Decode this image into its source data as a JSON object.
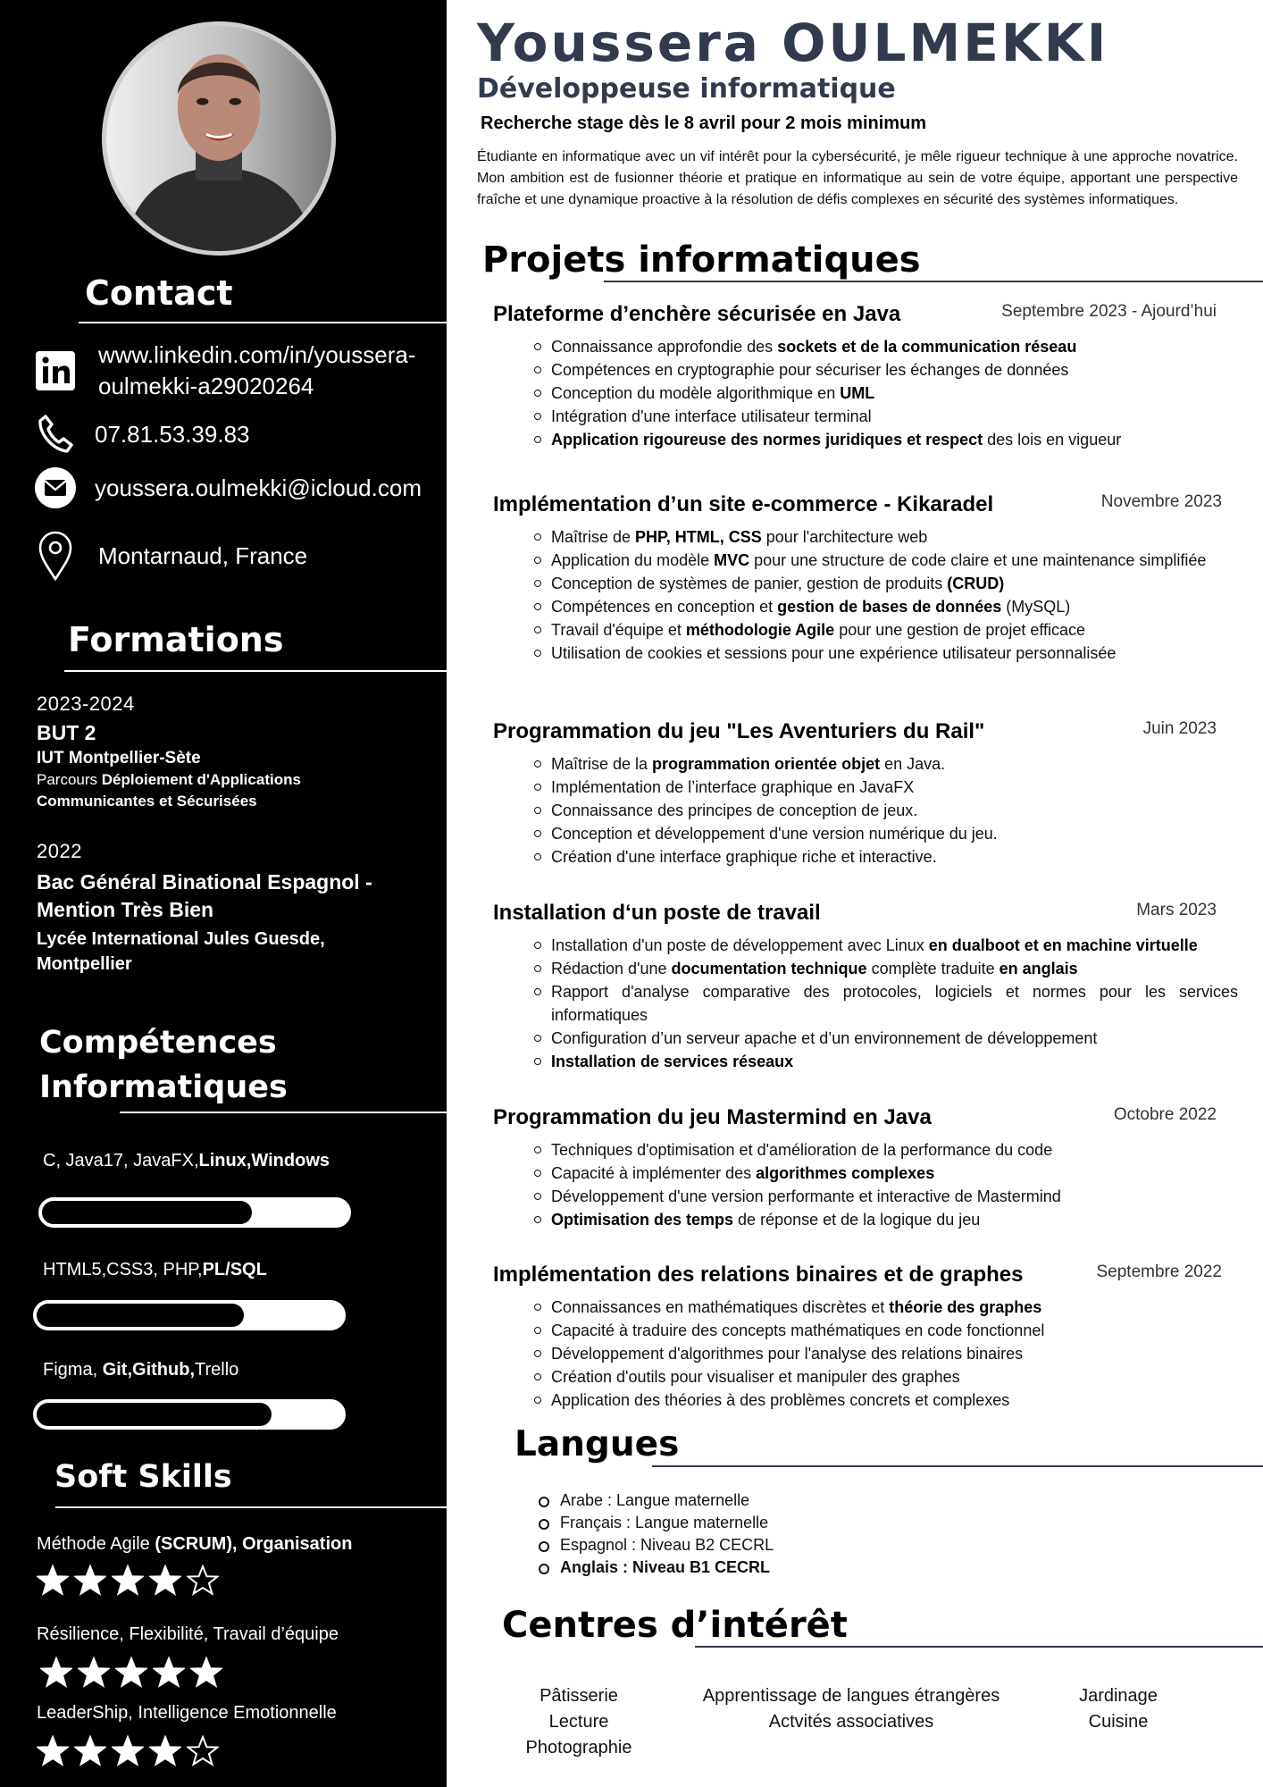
{
  "sidebar": {
    "contact_title": "Contact",
    "contact": {
      "linkedin_line1": "www.linkedin.com/in/youssera-",
      "linkedin_line2": "oulmekki-a29020264",
      "phone": "07.81.53.39.83",
      "email": "youssera.oulmekki@icloud.com",
      "location": "Montarnaud, France"
    },
    "formations_title": "Formations",
    "formations": [
      {
        "year": "2023-2024",
        "degree": "BUT 2",
        "school": "IUT Montpellier-Sète",
        "track_prefix": "Parcours ",
        "track_line1": "Déploiement d'Applications",
        "track_line2": "Communicantes et Sécurisées"
      },
      {
        "year": "2022",
        "degree_line1": "Bac Général Binational Espagnol -",
        "degree_line2": "Mention Très Bien",
        "school_line1": "Lycée International Jules Guesde,",
        "school_line2": "Montpellier"
      }
    ],
    "skills_title_line1": "Compétences",
    "skills_title_line2": "Informatiques",
    "skills": [
      {
        "plain": "C, Java17, JavaFX,",
        "bold": "Linux,Windows",
        "level_pct": 68
      },
      {
        "plain": "HTML5,CSS3, PHP,",
        "bold": "PL/SQL",
        "level_pct": 67
      },
      {
        "plain": "Figma, ",
        "bold": "Git,Github,",
        "plain2": "Trello",
        "level_pct": 76
      }
    ],
    "soft_title": "Soft Skills",
    "soft_skills": [
      {
        "plain": "Méthode Agile ",
        "bold": "(SCRUM), Organisation",
        "stars": 4,
        "max": 5
      },
      {
        "plain": "Résilience, Flexibilité, Travail d’équipe",
        "stars": 5,
        "max": 5
      },
      {
        "plain": "LeaderShip, Intelligence Emotionnelle",
        "stars": 4,
        "max": 5
      }
    ]
  },
  "header": {
    "name": "Youssera OULMEKKI",
    "role": "Développeuse informatique",
    "seeking": "Recherche stage dès le 8 avril pour 2 mois minimum",
    "summary": "Étudiante en informatique avec un vif intérêt pour la cybersécurité, je mêle rigueur technique à une approche novatrice. Mon ambition est de fusionner théorie et pratique en informatique au sein de votre équipe, apportant une perspective fraîche et une dynamique proactive à la résolution de défis complexes en sécurité des systèmes informatiques."
  },
  "projects_title": "Projets informatiques",
  "projects": [
    {
      "title": "Plateforme d’enchère sécurisée en Java",
      "date": "Septembre 2023 -  Ajourd’hui",
      "bullets": [
        [
          [
            "Connaissance approfondie des ",
            0
          ],
          [
            "sockets et de la communication réseau",
            1
          ]
        ],
        [
          [
            "Compétences en cryptographie pour sécuriser les échanges de données",
            0
          ]
        ],
        [
          [
            "Conception du modèle algorithmique en ",
            0
          ],
          [
            "UML",
            1
          ]
        ],
        [
          [
            "Intégration d'une interface utilisateur terminal",
            0
          ]
        ],
        [
          [
            "Application rigoureuse des normes juridiques et respect",
            1
          ],
          [
            " des lois en vigueur",
            0
          ]
        ]
      ]
    },
    {
      "title": "Implémentation d’un site e-commerce - Kikaradel",
      "date": "Novembre 2023",
      "bullets": [
        [
          [
            "Maîtrise de ",
            0
          ],
          [
            "PHP, HTML, CSS",
            1
          ],
          [
            " pour l'architecture web",
            0
          ]
        ],
        [
          [
            "Application du modèle ",
            0
          ],
          [
            "MVC",
            1
          ],
          [
            " pour une structure de code claire et une maintenance simplifiée",
            0
          ]
        ],
        [
          [
            "Conception de systèmes de panier, gestion de produits ",
            0
          ],
          [
            "(CRUD)",
            1
          ]
        ],
        [
          [
            "Compétences en conception et ",
            0
          ],
          [
            "gestion de bases de données",
            1
          ],
          [
            " (MySQL)",
            0
          ]
        ],
        [
          [
            "Travail d'équipe et ",
            0
          ],
          [
            "méthodologie Agile",
            1
          ],
          [
            " pour une gestion de projet efficace",
            0
          ]
        ],
        [
          [
            "Utilisation de cookies et sessions pour une expérience utilisateur personnalisée",
            0
          ]
        ]
      ]
    },
    {
      "title": "Programmation du jeu \"Les Aventuriers du Rail\"",
      "date": "Juin  2023",
      "bullets": [
        [
          [
            "Maîtrise de la ",
            0
          ],
          [
            "programmation orientée objet",
            1
          ],
          [
            " en Java.",
            0
          ]
        ],
        [
          [
            "Implémentation de l’interface graphique en JavaFX",
            0
          ]
        ],
        [
          [
            "Connaissance des principes de conception de jeux.",
            0
          ]
        ],
        [
          [
            "Conception et développement d'une version numérique du jeu.",
            0
          ]
        ],
        [
          [
            "Création d'une interface graphique riche et interactive.",
            0
          ]
        ]
      ]
    },
    {
      "title": "Installation d‘un poste de travail",
      "date": "Mars  2023",
      "bullets": [
        [
          [
            "Installation d'un poste de développement avec Linux ",
            0
          ],
          [
            "en dualboot et en machine virtuelle",
            1
          ]
        ],
        [
          [
            "Rédaction d'une ",
            0
          ],
          [
            "documentation technique",
            1
          ],
          [
            " complète traduite ",
            0
          ],
          [
            "en anglais",
            1
          ]
        ],
        [
          [
            "Rapport d'analyse comparative des protocoles, logiciels et normes pour les services informatiques",
            0
          ]
        ],
        [
          [
            "Configuration d’un serveur apache et d’un environnement de développement",
            0
          ]
        ],
        [
          [
            "Installation de services réseaux",
            1
          ]
        ]
      ]
    },
    {
      "title": "Programmation du jeu Mastermind en Java",
      "date": "Octobre  2022",
      "bullets": [
        [
          [
            "Techniques d'optimisation et d'amélioration de la performance du code",
            0
          ]
        ],
        [
          [
            "Capacité à implémenter des ",
            0
          ],
          [
            "algorithmes complexes",
            1
          ]
        ],
        [
          [
            "Développement d'une version performante et interactive de Mastermind",
            0
          ]
        ],
        [
          [
            "Optimisation des temps",
            1
          ],
          [
            " de réponse et de la logique du jeu",
            0
          ]
        ]
      ]
    },
    {
      "title": "Implémentation des relations binaires et de graphes",
      "date": "Septembre  2022",
      "bullets": [
        [
          [
            "Connaissances en mathématiques discrètes et ",
            0
          ],
          [
            "théorie des graphes",
            1
          ]
        ],
        [
          [
            "Capacité à traduire des concepts mathématiques en code fonctionnel",
            0
          ]
        ],
        [
          [
            "Développement d'algorithmes pour l'analyse des relations binaires",
            0
          ]
        ],
        [
          [
            "Création d'outils pour visualiser et manipuler des graphes",
            0
          ]
        ],
        [
          [
            "Application des théories à des problèmes concrets et complexes",
            0
          ]
        ]
      ]
    }
  ],
  "languages_title": "Langues",
  "languages": [
    {
      "text": "Arabe : Langue maternelle",
      "bold": false
    },
    {
      "text": "Français : Langue maternelle",
      "bold": false
    },
    {
      "text": "Espagnol : Niveau B2 CECRL",
      "bold": false
    },
    {
      "text": "Anglais : Niveau B1 CECRL",
      "bold": true
    }
  ],
  "interests_title": "Centres d’intérêt",
  "interests": [
    [
      "Pâtisserie",
      "Lecture",
      "Photographie"
    ],
    [
      "Apprentissage de langues étrangères",
      "Actvités associatives"
    ],
    [
      "Jardinage",
      "Cuisine"
    ]
  ]
}
